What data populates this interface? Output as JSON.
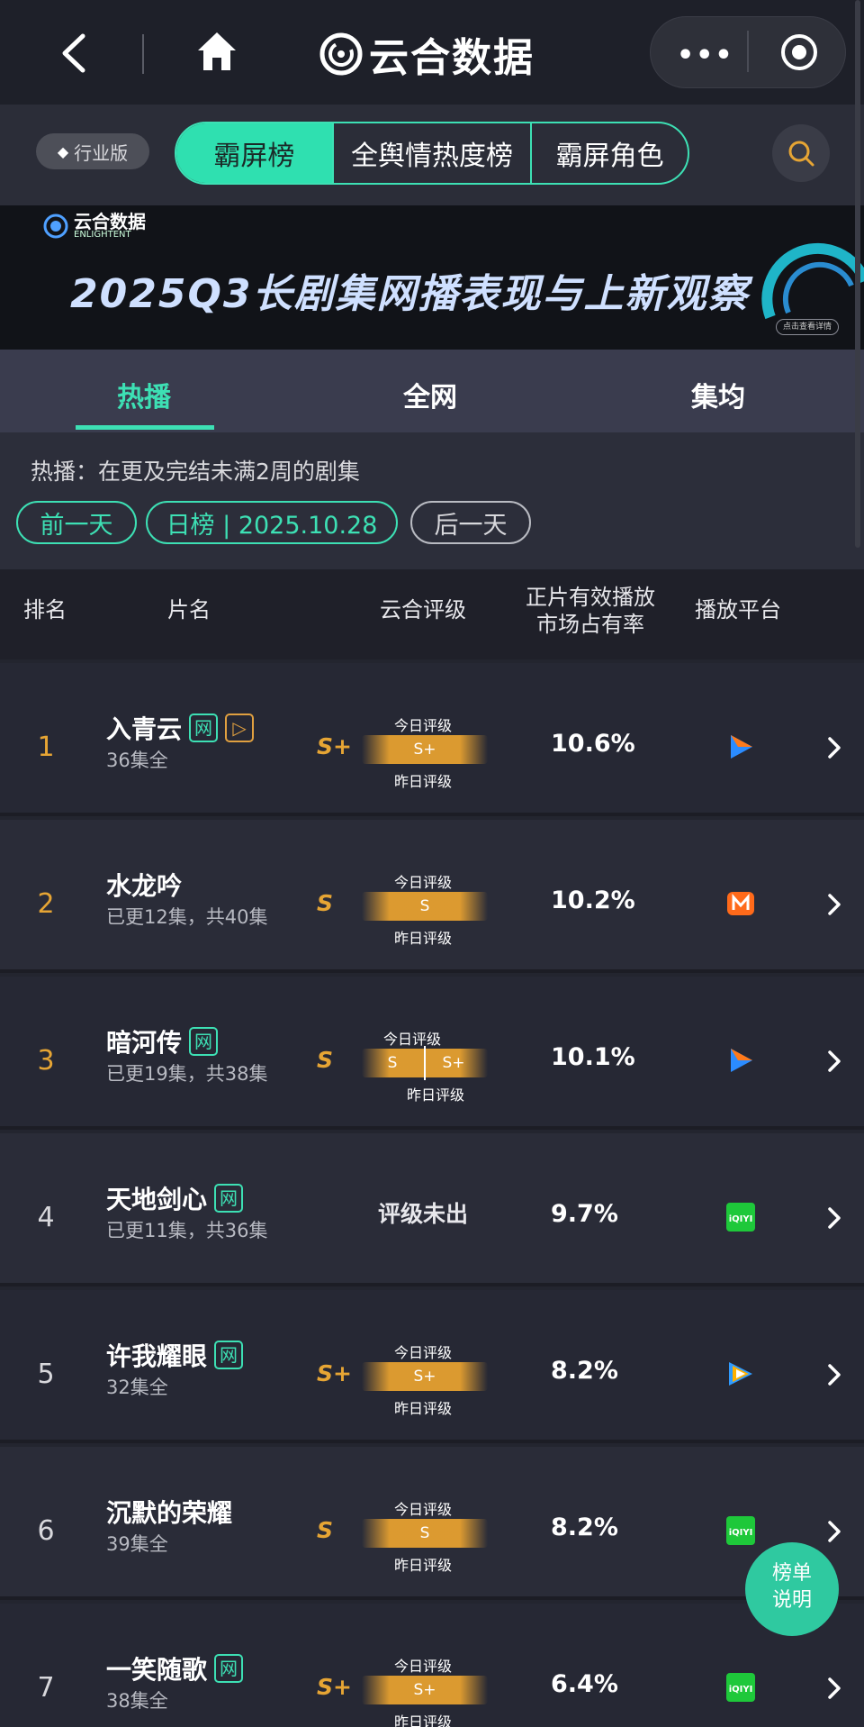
{
  "nav": {
    "title": "云合数据",
    "more": "•••"
  },
  "category": {
    "badge": "行业版",
    "tabs": [
      "霸屏榜",
      "全舆情热度榜",
      "霸屏角色"
    ]
  },
  "banner": {
    "logo_cn": "云合数据",
    "logo_en": "ENLIGHTENT",
    "headline": "2025Q3长剧集网播表现与上新观察",
    "cta": "点击查看详情"
  },
  "main_tabs": [
    "热播",
    "全网",
    "集均"
  ],
  "info": {
    "desc": "热播：在更及完结未满2周的剧集",
    "prev": "前一天",
    "date": "日榜 | 2025.10.28",
    "next": "后一天"
  },
  "table": {
    "headers": {
      "rank": "排名",
      "title": "片名",
      "grade": "云合评级",
      "share": "正片有效播放\n市场占有率",
      "platform": "播放平台"
    },
    "today_label": "今日评级",
    "yesterday_label": "昨日评级",
    "rows": [
      {
        "rank": "1",
        "title": "入青云",
        "tags": [
          "网",
          "▷"
        ],
        "sub": "36集全",
        "grade": "S+",
        "today": "S+",
        "yesterday": "",
        "share": "10.6%",
        "platform": "youku-icon",
        "rank_color": "#e6a534"
      },
      {
        "rank": "2",
        "title": "水龙吟",
        "tags": [],
        "sub": "已更12集，共40集",
        "grade": "S",
        "today": "S",
        "yesterday": "",
        "share": "10.2%",
        "platform": "mgtv-icon",
        "rank_color": "#e6a534"
      },
      {
        "rank": "3",
        "title": "暗河传",
        "tags": [
          "网"
        ],
        "sub": "已更19集，共38集",
        "grade": "S",
        "today": "S",
        "yesterday": "S+",
        "share": "10.1%",
        "platform": "youku-icon",
        "rank_color": "#e6a534"
      },
      {
        "rank": "4",
        "title": "天地剑心",
        "tags": [
          "网"
        ],
        "sub": "已更11集，共36集",
        "grade": "",
        "notyet": "评级未出",
        "share": "9.7%",
        "platform": "iqiyi-icon",
        "rank_color": "#d8d8dc"
      },
      {
        "rank": "5",
        "title": "许我耀眼",
        "tags": [
          "网"
        ],
        "sub": "32集全",
        "grade": "S+",
        "today": "S+",
        "yesterday": "",
        "share": "8.2%",
        "platform": "tencent-video-icon",
        "rank_color": "#d8d8dc"
      },
      {
        "rank": "6",
        "title": "沉默的荣耀",
        "tags": [],
        "sub": "39集全",
        "grade": "S",
        "today": "S",
        "yesterday": "",
        "share": "8.2%",
        "platform": "iqiyi-icon",
        "rank_color": "#d8d8dc"
      },
      {
        "rank": "7",
        "title": "一笑随歌",
        "tags": [
          "网"
        ],
        "sub": "38集全",
        "grade": "S+",
        "today": "S+",
        "yesterday": "",
        "share": "6.4%",
        "platform": "iqiyi-icon",
        "rank_color": "#d8d8dc"
      }
    ]
  },
  "fab": {
    "line1": "榜单",
    "line2": "说明"
  },
  "colors": {
    "accent": "#3de0b4",
    "gold": "#e6a534"
  }
}
